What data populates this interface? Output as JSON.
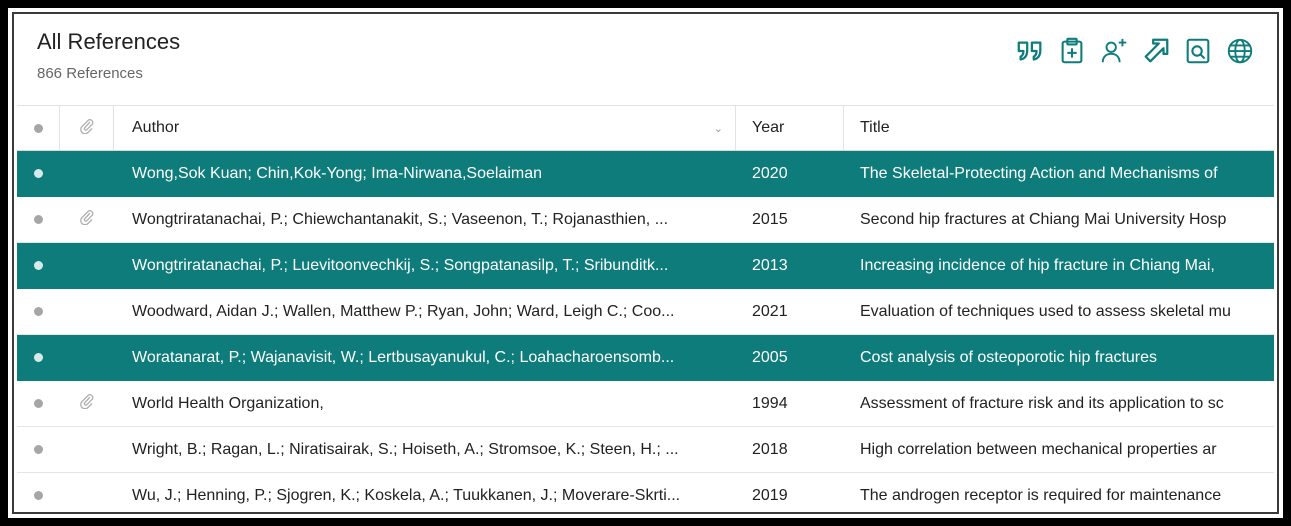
{
  "header": {
    "title": "All References",
    "count": "866 References"
  },
  "toolbar": {
    "icons": [
      "quote-icon",
      "clipboard-add-icon",
      "add-user-icon",
      "share-arrow-icon",
      "find-pdf-icon",
      "online-search-icon"
    ]
  },
  "table": {
    "columns": {
      "author": "Author",
      "year": "Year",
      "title": "Title"
    },
    "rows": [
      {
        "author": "Wong,Sok Kuan; Chin,Kok-Yong; Ima-Nirwana,Soelaiman",
        "year": "2020",
        "title": "The Skeletal-Protecting Action and Mechanisms of",
        "attachment": false,
        "selected": true
      },
      {
        "author": "Wongtriratanachai, P.; Chiewchantanakit, S.; Vaseenon, T.; Rojanasthien, ...",
        "year": "2015",
        "title": "Second hip fractures at Chiang Mai University Hosp",
        "attachment": true,
        "selected": false
      },
      {
        "author": "Wongtriratanachai, P.; Luevitoonvechkij, S.; Songpatanasilp, T.; Sribunditk...",
        "year": "2013",
        "title": "Increasing incidence of hip fracture in Chiang Mai,",
        "attachment": false,
        "selected": true
      },
      {
        "author": "Woodward, Aidan J.; Wallen, Matthew P.; Ryan, John; Ward, Leigh C.; Coo...",
        "year": "2021",
        "title": "Evaluation of techniques used to assess skeletal mu",
        "attachment": false,
        "selected": false
      },
      {
        "author": "Woratanarat, P.; Wajanavisit, W.; Lertbusayanukul, C.; Loahacharoensomb...",
        "year": "2005",
        "title": "Cost analysis of osteoporotic hip fractures",
        "attachment": false,
        "selected": true
      },
      {
        "author": "World Health Organization,",
        "year": "1994",
        "title": "Assessment of fracture risk and its application to sc",
        "attachment": true,
        "selected": false
      },
      {
        "author": "Wright, B.; Ragan, L.; Niratisairak, S.; Hoiseth, A.; Stromsoe, K.; Steen, H.; ...",
        "year": "2018",
        "title": "High correlation between mechanical properties ar",
        "attachment": false,
        "selected": false
      },
      {
        "author": "Wu, J.; Henning, P.; Sjogren, K.; Koskela, A.; Tuukkanen, J.; Moverare-Skrti...",
        "year": "2019",
        "title": "The androgen receptor is required for maintenance",
        "attachment": false,
        "selected": false
      }
    ]
  },
  "colors": {
    "accent": "#0e7c7b",
    "selected_text": "#ffffff",
    "dot": "#a6a6a6"
  }
}
